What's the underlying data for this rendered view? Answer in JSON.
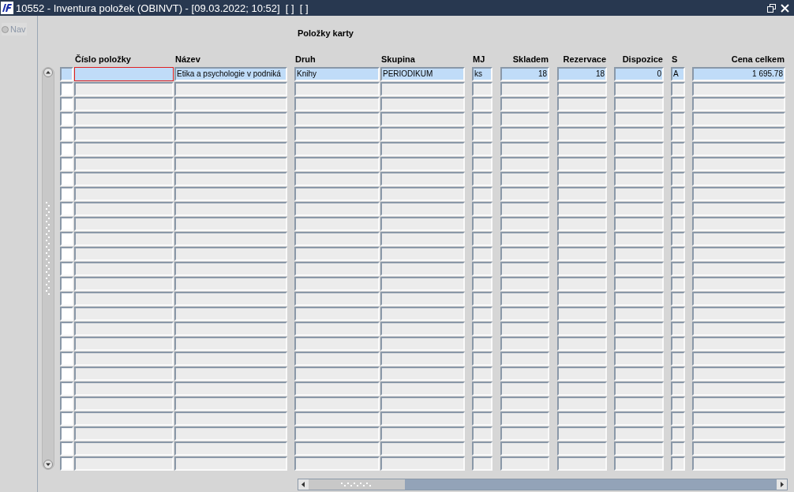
{
  "window": {
    "title": "10552 - Inventura položek (OBINVT) - [09.03.2022; 10:52]  [ ]  [ ]"
  },
  "nav": {
    "label": "Nav",
    "selected": false
  },
  "block_title": "Položky karty",
  "columns": [
    {
      "kind": "check"
    },
    {
      "label": "Číslo položky",
      "kind": "text"
    },
    {
      "label": "Název",
      "kind": "text"
    },
    {
      "label": "Druh",
      "kind": "text"
    },
    {
      "label": "Skupina",
      "kind": "text"
    },
    {
      "label": "MJ",
      "kind": "text"
    },
    {
      "label": "Skladem",
      "kind": "number"
    },
    {
      "label": "Rezervace",
      "kind": "number"
    },
    {
      "label": "Dispozice",
      "kind": "number"
    },
    {
      "label": "S",
      "kind": "text"
    },
    {
      "label": "Cena celkem",
      "kind": "number"
    }
  ],
  "rows": [
    {
      "current": true,
      "cells": [
        {
          "focused": false
        },
        {
          "focused": true
        },
        {
          "value": "Etika a psychologie v podniká",
          "focused": false
        },
        {
          "value": "Knihy",
          "focused": false
        },
        {
          "value": "PERIODIKUM",
          "focused": false
        },
        {
          "value": "ks",
          "focused": false
        },
        {
          "value": "18",
          "focused": false
        },
        {
          "value": "18",
          "focused": false
        },
        {
          "value": "0",
          "focused": false
        },
        {
          "value": "A",
          "focused": false
        },
        {
          "value": "1 695.78",
          "focused": false
        }
      ]
    },
    {
      "current": false
    },
    {
      "current": false
    },
    {
      "current": false
    },
    {
      "current": false
    },
    {
      "current": false
    },
    {
      "current": false
    },
    {
      "current": false
    },
    {
      "current": false
    },
    {
      "current": false
    },
    {
      "current": false
    },
    {
      "current": false
    },
    {
      "current": false
    },
    {
      "current": false
    },
    {
      "current": false
    },
    {
      "current": false
    },
    {
      "current": false
    },
    {
      "current": false
    },
    {
      "current": false
    },
    {
      "current": false
    },
    {
      "current": false
    },
    {
      "current": false
    },
    {
      "current": false
    },
    {
      "current": false
    },
    {
      "current": false
    },
    {
      "current": false
    },
    {
      "current": false
    }
  ]
}
